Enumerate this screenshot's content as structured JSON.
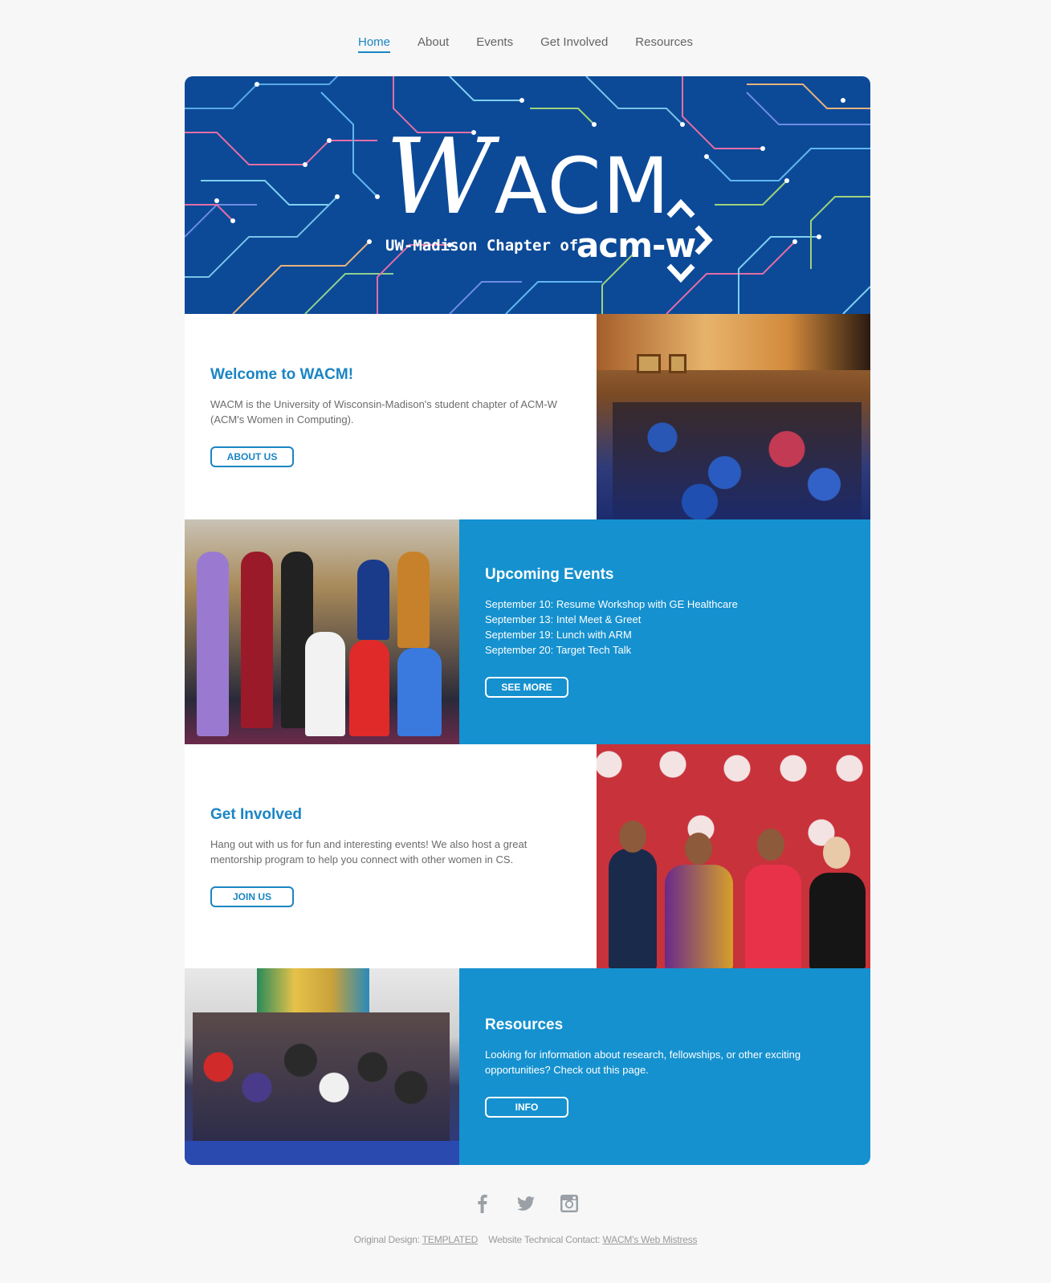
{
  "nav": {
    "items": [
      {
        "label": "Home",
        "active": true
      },
      {
        "label": "About"
      },
      {
        "label": "Events"
      },
      {
        "label": "Get Involved"
      },
      {
        "label": "Resources"
      }
    ]
  },
  "banner": {
    "logo_main": "WACM",
    "logo_sub": "UW-Madison Chapter of",
    "logo_acmw": "acm-w"
  },
  "welcome": {
    "title": "Welcome to WACM!",
    "body": "WACM is the University of Wisconsin-Madison's student chapter of ACM-W (ACM's Women in Computing).",
    "button": "About Us"
  },
  "events": {
    "title": "Upcoming Events",
    "items": [
      "September 10: Resume Workshop with GE Healthcare",
      "September 13: Intel Meet & Greet",
      "September 19: Lunch with ARM",
      "September 20: Target Tech Talk"
    ],
    "button": "See More"
  },
  "involved": {
    "title": "Get Involved",
    "body": "Hang out with us for fun and interesting events! We also host a great mentorship program to help you connect with other women in CS.",
    "button": "Join Us"
  },
  "resources": {
    "title": "Resources",
    "body": "Looking for information about research, fellowships, or other exciting opportunities? Check out this page.",
    "button": "Info"
  },
  "footer": {
    "social": [
      "facebook-icon",
      "twitter-icon",
      "instagram-icon"
    ],
    "design_label": "Original Design:",
    "design_link": "TEMPLATED",
    "contact_label": "Website Technical Contact:",
    "contact_link": "WACM's Web Mistress"
  },
  "colors": {
    "accent": "#1a85c4",
    "blue_panel": "#1591cf",
    "banner_bg": "#0c4a98",
    "page_bg": "#f7f7f7"
  }
}
